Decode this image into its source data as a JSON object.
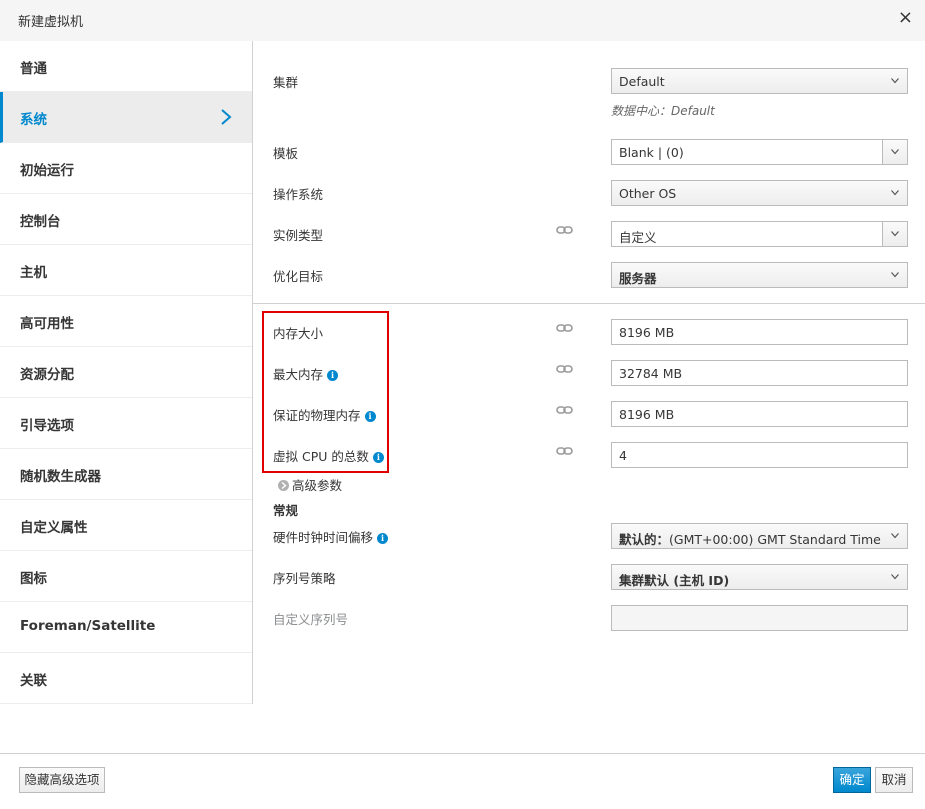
{
  "dialog": {
    "title": "新建虚拟机",
    "close_glyph": "×"
  },
  "sidebar": {
    "items": [
      {
        "label": "普通"
      },
      {
        "label": "系统",
        "active": true
      },
      {
        "label": "初始运行"
      },
      {
        "label": "控制台"
      },
      {
        "label": "主机"
      },
      {
        "label": "高可用性"
      },
      {
        "label": "资源分配"
      },
      {
        "label": "引导选项"
      },
      {
        "label": "随机数生成器"
      },
      {
        "label": "自定义属性"
      },
      {
        "label": "图标"
      },
      {
        "label": "Foreman/Satellite"
      },
      {
        "label": "关联"
      }
    ]
  },
  "form": {
    "cluster": {
      "label": "集群",
      "value": "Default",
      "note": "数据中心：Default"
    },
    "template": {
      "label": "模板",
      "value": "Blank |  (0)"
    },
    "os": {
      "label": "操作系统",
      "value": "Other OS"
    },
    "instance_type": {
      "label": "实例类型",
      "value": "自定义"
    },
    "optimize": {
      "label": "优化目标",
      "value": "服务器"
    },
    "memory": {
      "label": "内存大小",
      "value": "8196 MB"
    },
    "max_memory": {
      "label": "最大内存",
      "value": "32784 MB"
    },
    "guaranteed_memory": {
      "label": "保证的物理内存",
      "value": "8196 MB"
    },
    "vcpu": {
      "label": "虚拟 CPU 的总数",
      "value": "4"
    },
    "advanced": {
      "label": "高级参数"
    },
    "general_section": "常规",
    "hw_clock": {
      "label": "硬件时钟时间偏移",
      "value": "默认的：(GMT+00:00) GMT Standard Time",
      "value_prefix": "默认的：",
      "value_rest": "(GMT+00:00) GMT Standard Time"
    },
    "serial_policy": {
      "label": "序列号策略",
      "value": "集群默认 (主机 ID)"
    },
    "custom_serial": {
      "label": "自定义序列号",
      "value": ""
    }
  },
  "footer": {
    "hide_advanced": "隐藏高级选项",
    "ok": "确定",
    "cancel": "取消"
  },
  "colors": {
    "accent": "#0088ce",
    "highlight": "#e00000"
  }
}
